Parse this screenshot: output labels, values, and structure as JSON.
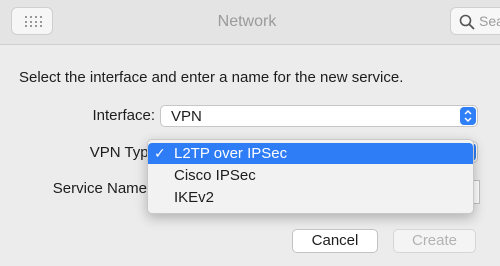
{
  "window": {
    "title": "Network",
    "search_placeholder": "Search",
    "search_icon": "magnifier-icon",
    "grid_icon": "grid-icon"
  },
  "dialog": {
    "prompt": "Select the interface and enter a name for the new service.",
    "interface": {
      "label": "Interface:",
      "value": "VPN"
    },
    "vpn_type": {
      "label": "VPN Type",
      "value": "L2TP over IPSec"
    },
    "service_name": {
      "label": "Service Name",
      "value": ""
    },
    "menu": {
      "items": [
        {
          "label": "L2TP over IPSec",
          "selected": true
        },
        {
          "label": "Cisco IPSec",
          "selected": false
        },
        {
          "label": "IKEv2",
          "selected": false
        }
      ],
      "check_mark": "✓"
    },
    "buttons": {
      "cancel": "Cancel",
      "create": "Create"
    }
  },
  "colors": {
    "accent": "#2e7cf6",
    "window_bg": "#ececec",
    "disabled_text": "#b3b3b3"
  }
}
